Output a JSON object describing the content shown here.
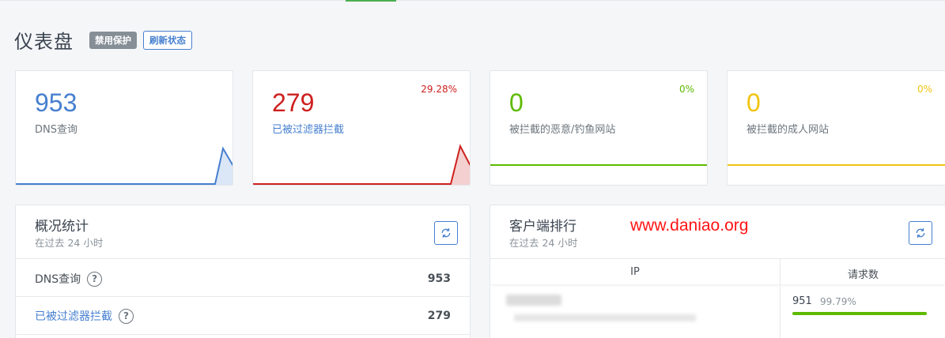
{
  "header": {
    "title": "仪表盘",
    "disable_protection_label": "禁用保护",
    "refresh_status_label": "刷新状态"
  },
  "stats": [
    {
      "value": "953",
      "label": "DNS查询",
      "percent": "",
      "color": "#467fcf"
    },
    {
      "value": "279",
      "label": "已被过滤器拦截",
      "percent": "29.28%",
      "color": "#cd201f"
    },
    {
      "value": "0",
      "label": "被拦截的恶意/钓鱼网站",
      "percent": "0%",
      "color": "#5eba00"
    },
    {
      "value": "0",
      "label": "被拦截的成人网站",
      "percent": "0%",
      "color": "#f1c40f"
    }
  ],
  "overview": {
    "title": "概况统计",
    "subtitle": "在过去 24 小时",
    "rows": [
      {
        "label": "DNS查询",
        "value": "953"
      },
      {
        "label": "已被过滤器拦截",
        "value": "279"
      }
    ]
  },
  "clients": {
    "title": "客户端排行",
    "subtitle": "在过去 24 小时",
    "col_ip": "IP",
    "col_requests": "请求数",
    "rows": [
      {
        "requests": "951",
        "percent": "99.79%",
        "fraction": 0.9979
      }
    ]
  },
  "watermark": "www.daniao.org",
  "icons": {
    "refresh": "refresh-icon",
    "help": "question-circle-icon"
  }
}
